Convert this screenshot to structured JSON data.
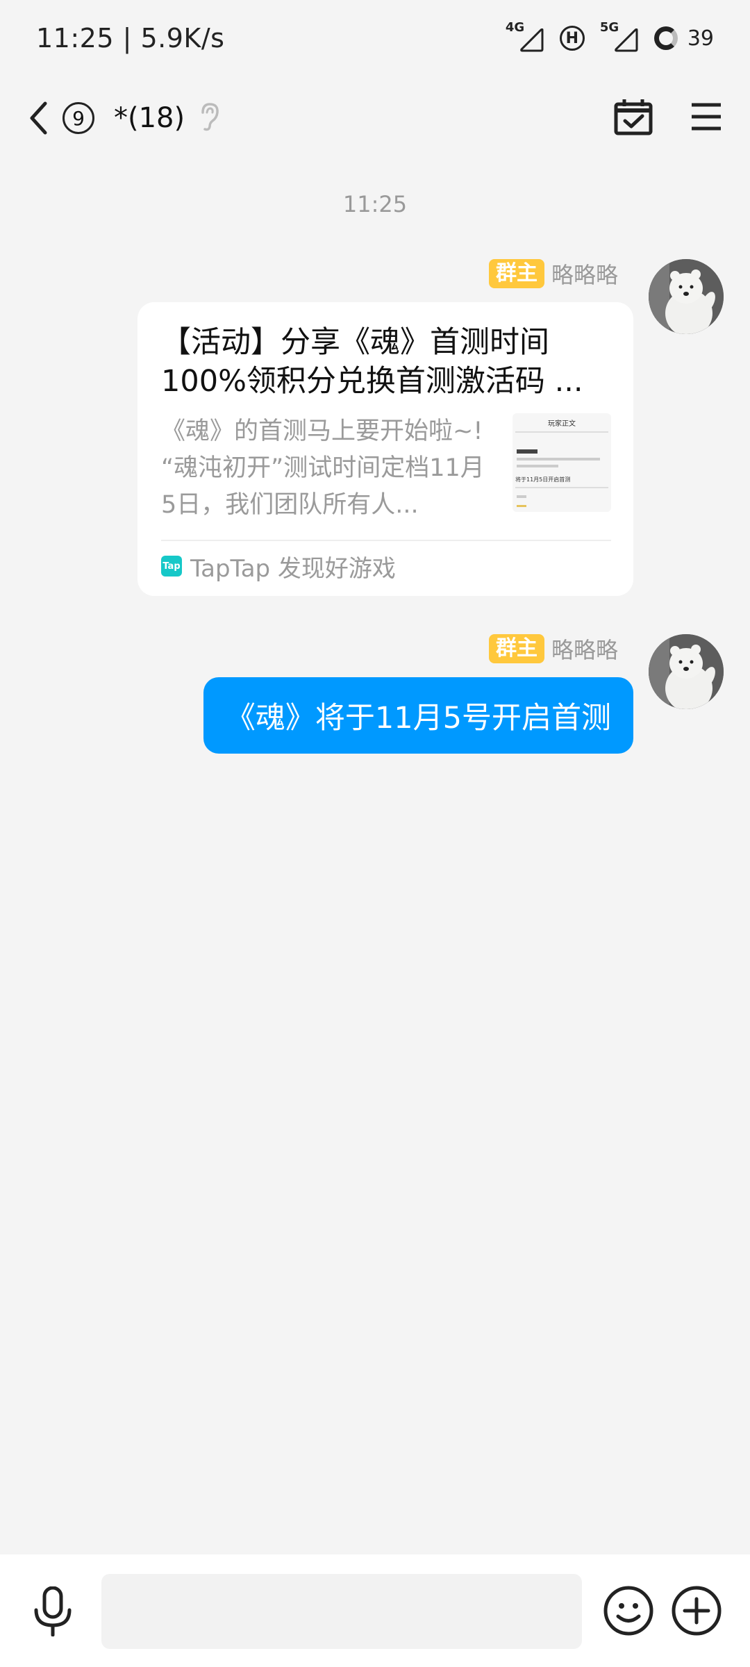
{
  "status_bar": {
    "time_speed": "11:25 | 5.9K/s",
    "sim1_tag": "4G",
    "hd_tag": "H",
    "sim2_tag": "5G",
    "battery": "39"
  },
  "header": {
    "unread_count": "9",
    "title": "*(18)"
  },
  "messages": {
    "timestamp": "11:25",
    "card_message": {
      "role": "群主",
      "sender": "略略略",
      "title": "【活动】分享《魂》首测时间100%领积分兑换首测激活码 ...",
      "description": "《魂》的首测马上要开始啦~! “魂沌初开”测试时间定档11月5日，我们团队所有人...",
      "thumbnail_heading": "玩家正文",
      "thumbnail_line": "将于11月5日开启首测",
      "source_logo": "Tap",
      "source": "TapTap 发现好游戏"
    },
    "text_message": {
      "role": "群主",
      "sender": "略略略",
      "text": "《魂》将于11月5号开启首测"
    }
  },
  "input": {
    "placeholder": ""
  },
  "colors": {
    "bubble": "#0099ff",
    "role_badge": "#ffc83d",
    "background": "#f4f4f4",
    "tap_logo": "#16c8c8"
  }
}
